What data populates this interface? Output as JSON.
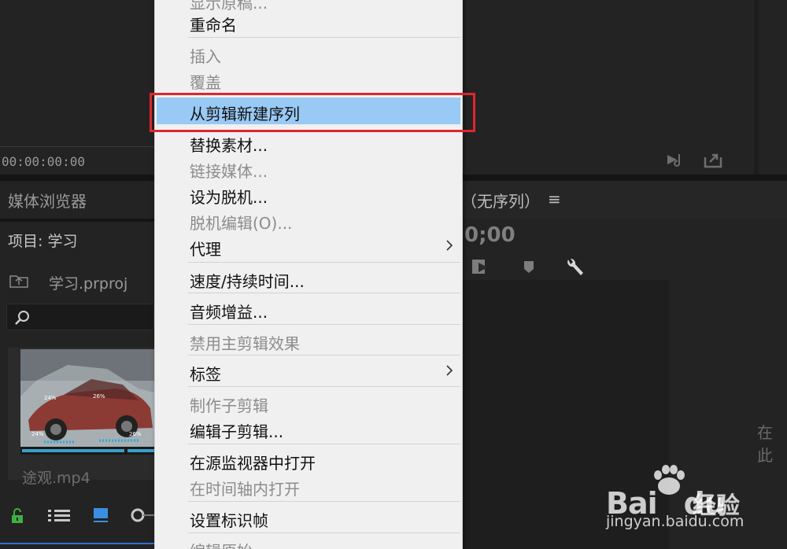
{
  "source_monitor": {
    "timecode": "00:00:00:00"
  },
  "media_browser": {
    "tab_label": "媒体浏览器"
  },
  "project": {
    "title": "项目: 学习",
    "file_name": "学习.prproj",
    "clip_name": "途观.mp4"
  },
  "timeline": {
    "sequence_label": "（无序列）",
    "menu_glyph": "≡",
    "timecode": "0;00",
    "drop_hint": "在此"
  },
  "context_menu": {
    "top_partial": "显示原稿...",
    "items": [
      {
        "label": "重命名",
        "enabled": true
      },
      {
        "label": "插入",
        "enabled": false
      },
      {
        "label": "覆盖",
        "enabled": false
      },
      {
        "label": "从剪辑新建序列",
        "enabled": true,
        "highlighted": true
      },
      {
        "label": "替换素材...",
        "enabled": true
      },
      {
        "label": "链接媒体...",
        "enabled": false
      },
      {
        "label": "设为脱机...",
        "enabled": true
      },
      {
        "label": "脱机编辑(O)...",
        "enabled": false
      },
      {
        "label": "代理",
        "enabled": true,
        "submenu": true
      },
      {
        "label": "速度/持续时间...",
        "enabled": true
      },
      {
        "label": "音频增益...",
        "enabled": true
      },
      {
        "label": "禁用主剪辑效果",
        "enabled": false
      },
      {
        "label": "标签",
        "enabled": true,
        "submenu": true
      },
      {
        "label": "制作子剪辑",
        "enabled": false
      },
      {
        "label": "编辑子剪辑...",
        "enabled": true
      },
      {
        "label": "在源监视器中打开",
        "enabled": true
      },
      {
        "label": "在时间轴内打开",
        "enabled": false
      },
      {
        "label": "设置标识帧",
        "enabled": true
      },
      {
        "label": "编辑原始",
        "enabled": false
      }
    ]
  },
  "watermark": {
    "brand": "Bai",
    "brand_du": "du",
    "cn": "经验",
    "url": "jingyan.baidu.com"
  },
  "thumbnail_labels": [
    "24%",
    "24%",
    "26%",
    "26%"
  ],
  "colors": {
    "highlight": "#99c9f5",
    "annotation_box": "#e0262d",
    "panel_bg": "#232323"
  }
}
